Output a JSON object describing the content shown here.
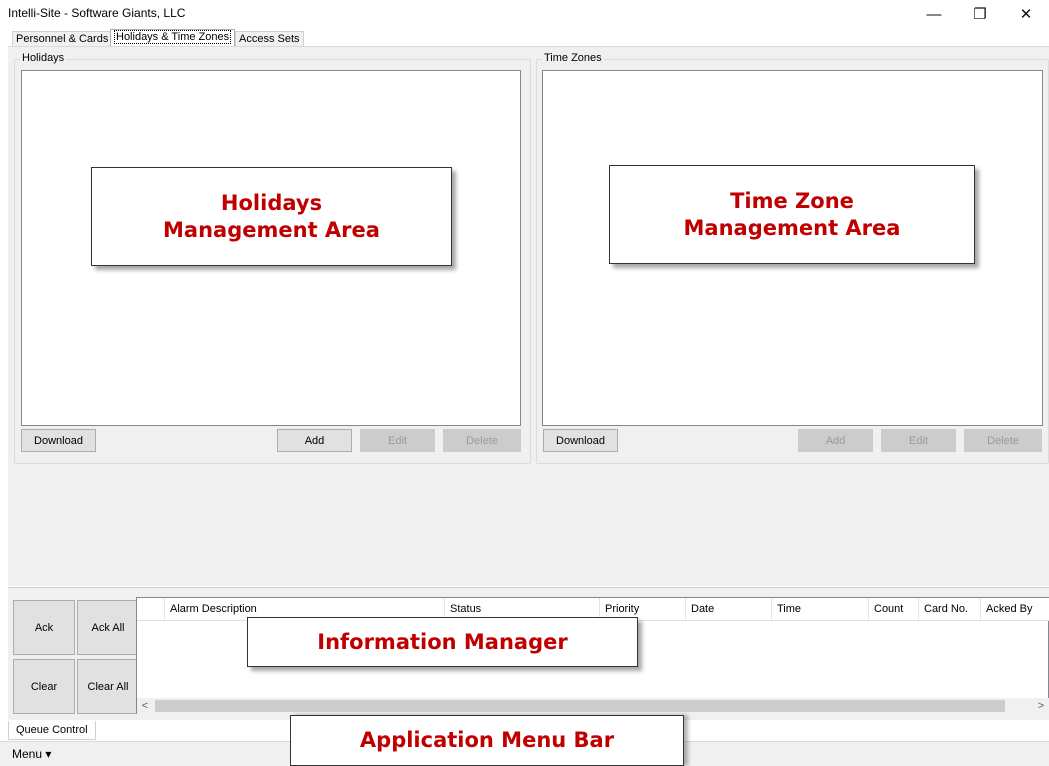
{
  "window": {
    "title": "Intelli-Site - Software Giants, LLC",
    "minimize_glyph": "—",
    "restore_glyph": "❐",
    "close_glyph": "✕"
  },
  "tabs": [
    {
      "label": "Personnel & Cards",
      "active": false
    },
    {
      "label": "Holidays & Time Zones",
      "active": true
    },
    {
      "label": "Access Sets",
      "active": false
    }
  ],
  "holidays": {
    "caption": "Holidays",
    "download_label": "Download",
    "add_label": "Add",
    "edit_label": "Edit",
    "delete_label": "Delete"
  },
  "time_zones": {
    "caption": "Time Zones",
    "download_label": "Download",
    "add_label": "Add",
    "edit_label": "Edit",
    "delete_label": "Delete"
  },
  "callouts": {
    "holidays": {
      "line1": "Holidays",
      "line2": "Management Area"
    },
    "time_zones": {
      "line1": "Time Zone",
      "line2": "Management Area"
    },
    "information_manager": "Information Manager",
    "application_menu_bar": "Application Menu Bar",
    "color": "#c00000"
  },
  "queue": {
    "ack_label": "Ack",
    "ack_all_label": "Ack All",
    "clear_label": "Clear",
    "clear_all_label": "Clear All",
    "tab_label": "Queue Control"
  },
  "alarm_grid": {
    "columns": [
      "Alarm Description",
      "Status",
      "Priority",
      "Date",
      "Time",
      "Count",
      "Card No.",
      "Acked By"
    ],
    "rows": [],
    "scroll_left_glyph": "<",
    "scroll_right_glyph": ">"
  },
  "menu": {
    "label": "Menu ▾"
  }
}
